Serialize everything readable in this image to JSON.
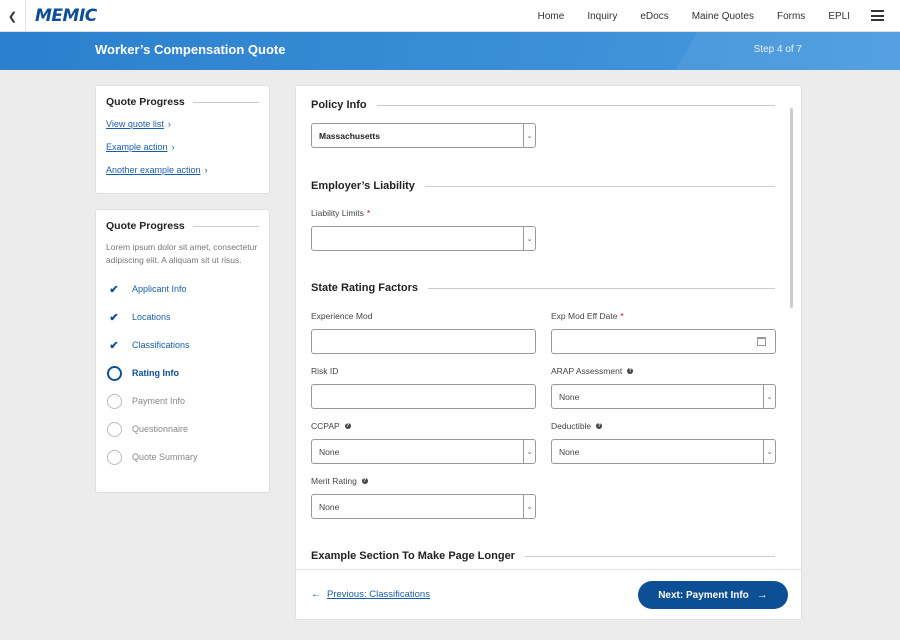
{
  "nav": {
    "back_icon": "chevron-left-icon",
    "logo": "MEMIC",
    "links": [
      "Home",
      "Inquiry",
      "eDocs",
      "Maine Quotes",
      "Forms",
      "EPLI"
    ],
    "menu_icon": "hamburger-icon"
  },
  "banner": {
    "title": "Worker’s Compensation Quote",
    "step": "Step 4 of 7"
  },
  "sidebar": {
    "card1": {
      "title": "Quote Progress",
      "links": [
        "View quote list",
        "Example action",
        "Another example action"
      ]
    },
    "card2": {
      "title": "Quote Progress",
      "description": "Lorem ipsum dolor sit amet, consectetur adipiscing elit. A aliquam sit ut risus.",
      "steps": [
        {
          "label": "Applicant Info",
          "status": "complete"
        },
        {
          "label": "Locations",
          "status": "complete"
        },
        {
          "label": "Classifications",
          "status": "complete"
        },
        {
          "label": "Rating Info",
          "status": "current"
        },
        {
          "label": "Payment Info",
          "status": "incomplete"
        },
        {
          "label": "Questionnaire",
          "status": "incomplete"
        },
        {
          "label": "Quote Summary",
          "status": "incomplete"
        }
      ]
    }
  },
  "form": {
    "policy_info": {
      "title": "Policy Info",
      "state_value": "Massachusetts"
    },
    "employers_liability": {
      "title": "Employer’s Liability",
      "liability_limits_label": "Liability Limits",
      "liability_limits_value": ""
    },
    "state_rating": {
      "title": "State Rating Factors",
      "experience_mod_label": "Experience Mod",
      "experience_mod_value": "",
      "exp_mod_eff_date_label": "Exp Mod Eff Date",
      "exp_mod_eff_date_value": "",
      "risk_id_label": "Risk ID",
      "risk_id_value": "",
      "arap_label": "ARAP Assessment",
      "arap_value": "None",
      "ccpap_label": "CCPAP",
      "ccpap_value": "None",
      "deductible_label": "Deductible",
      "deductible_value": "None",
      "merit_rating_label": "Merit Rating",
      "merit_rating_value": "None"
    },
    "example_section": {
      "title": "Example Section To Make Page Longer"
    },
    "required_marker": "*"
  },
  "footer": {
    "previous_label": "Previous: Classifications",
    "next_label": "Next: Payment Info"
  },
  "colors": {
    "brand": "#0d4f95",
    "banner": "#3a8ed6",
    "link": "#1a5ea8",
    "required": "#d0021b"
  }
}
